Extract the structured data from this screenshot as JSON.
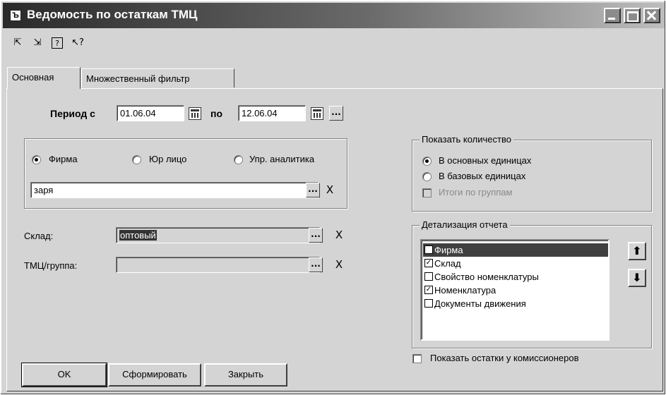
{
  "window": {
    "title": "Ведомость по остаткам ТМЦ",
    "app_icon": "Ъ"
  },
  "toolbar": {
    "icons": [
      "open-settings-icon",
      "save-settings-icon",
      "help-icon",
      "context-help-icon"
    ],
    "glyphs": [
      "⇱",
      "⇲",
      "?",
      "↖?"
    ]
  },
  "tabs": [
    {
      "label": "Основная",
      "active": true
    },
    {
      "label": "Множественный фильтр",
      "active": false
    }
  ],
  "period": {
    "from_label": "Период с",
    "from_value": "01.06.04",
    "to_label": "по",
    "to_value": "12.06.04",
    "more_label": "..."
  },
  "entity": {
    "options": [
      {
        "label": "Фирма",
        "selected": true
      },
      {
        "label": "Юр лицо",
        "selected": false
      },
      {
        "label": "Упр. аналитика",
        "selected": false
      }
    ],
    "value": "заря"
  },
  "warehouse": {
    "label": "Склад:",
    "value": "оптовый"
  },
  "item_group": {
    "label": "ТМЦ/группа:",
    "value": ""
  },
  "select_button_label": "...",
  "clear_button_label": "X",
  "quantity": {
    "title": "Показать количество",
    "options": [
      {
        "label": "В основных единицах",
        "selected": true
      },
      {
        "label": "В базовых единицах",
        "selected": false
      }
    ],
    "group_totals_label": "Итоги по группам",
    "group_totals_checked": false
  },
  "detail": {
    "title": "Детализация отчета",
    "items": [
      {
        "label": "Фирма",
        "checked": false,
        "selected": true
      },
      {
        "label": "Склад",
        "checked": true,
        "selected": false
      },
      {
        "label": "Свойство номенклатуры",
        "checked": false,
        "selected": false
      },
      {
        "label": "Номенклатура",
        "checked": true,
        "selected": false
      },
      {
        "label": "Документы движения",
        "checked": false,
        "selected": false
      }
    ],
    "up_glyph": "⬆",
    "down_glyph": "⬇"
  },
  "commission": {
    "label": "Показать остатки у комиссионеров",
    "checked": false
  },
  "buttons": {
    "ok": "OK",
    "form": "Сформировать",
    "close": "Закрыть"
  },
  "colors": {
    "window_bg": "#d4d4d4",
    "selection_bg": "#404040",
    "title_bar_dark": "#2a2a2a"
  }
}
